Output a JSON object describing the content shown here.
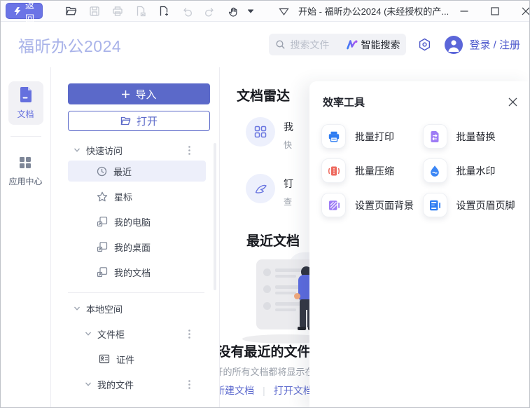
{
  "titlebar": {
    "back_label": "返回",
    "title": "开始 - 福昕办公2024 (未经授权的产...",
    "toolbar_icons": [
      {
        "name": "open-folder-icon",
        "enabled": true
      },
      {
        "name": "save-icon",
        "enabled": false
      },
      {
        "name": "print-icon",
        "enabled": false
      },
      {
        "name": "remove-page-icon",
        "enabled": false
      },
      {
        "name": "new-document-icon",
        "enabled": true
      },
      {
        "name": "undo-icon",
        "enabled": false
      },
      {
        "name": "redo-icon",
        "enabled": false
      },
      {
        "name": "hand-tool-icon",
        "enabled": true
      }
    ]
  },
  "header": {
    "app_title": "福昕办公2024",
    "search_placeholder": "搜索文件",
    "ai_label": "智能搜索",
    "login_label": "登录 / 注册"
  },
  "rail": {
    "items": [
      {
        "label": "文档",
        "icon": "document-icon",
        "active": true
      },
      {
        "label": "应用中心",
        "icon": "apps-grid-icon",
        "active": false
      }
    ]
  },
  "sidebar": {
    "import_label": "导入",
    "open_label": "打开",
    "tree": [
      {
        "label": "快速访问",
        "type": "group"
      },
      {
        "label": "最近",
        "icon": "clock-icon",
        "selected": true
      },
      {
        "label": "星标",
        "icon": "star-icon"
      },
      {
        "label": "我的电脑",
        "icon": "shortcut-icon"
      },
      {
        "label": "我的桌面",
        "icon": "shortcut-icon"
      },
      {
        "label": "我的文档",
        "icon": "shortcut-icon"
      },
      {
        "label": "本地空间",
        "type": "group"
      },
      {
        "label": "文件柜",
        "type": "group"
      },
      {
        "label": "证件",
        "icon": "id-card-icon"
      },
      {
        "label": "我的文件",
        "type": "group"
      }
    ]
  },
  "main": {
    "radar": {
      "title": "文档雷达",
      "items": [
        {
          "title": "我",
          "desc": "快",
          "icon": "grid-circle-icon"
        },
        {
          "title": "钉",
          "desc": "查",
          "icon": "wing-icon"
        }
      ]
    },
    "recent": {
      "title": "最近文档",
      "empty_title": "没有最近的文件",
      "empty_desc": "您打开的所有文档都将显示在这里",
      "link_new": "新建文档",
      "link_divider": "|",
      "link_open": "打开文档"
    }
  },
  "tools": {
    "title": "效率工具",
    "items": [
      {
        "label": "批量打印",
        "icon": "printer-icon",
        "color": "#2f7df2"
      },
      {
        "label": "批量替换",
        "icon": "replace-doc-icon",
        "color": "#9e7cf5"
      },
      {
        "label": "批量压缩",
        "icon": "compress-icon",
        "color": "#ee6a5f"
      },
      {
        "label": "批量水印",
        "icon": "watermark-drop-icon",
        "color": "#3b86f5"
      },
      {
        "label": "设置页面背景",
        "icon": "page-background-icon",
        "color": "#9e7cf5"
      },
      {
        "label": "设置页眉页脚",
        "icon": "header-footer-icon",
        "color": "#2f7df2"
      }
    ]
  },
  "colors": {
    "accent": "#5b69c9",
    "back_button": "#6b74e6",
    "brand_title": "#a9b3e9",
    "login": "#4d58cd",
    "selected_row_bg": "#edeffa"
  }
}
